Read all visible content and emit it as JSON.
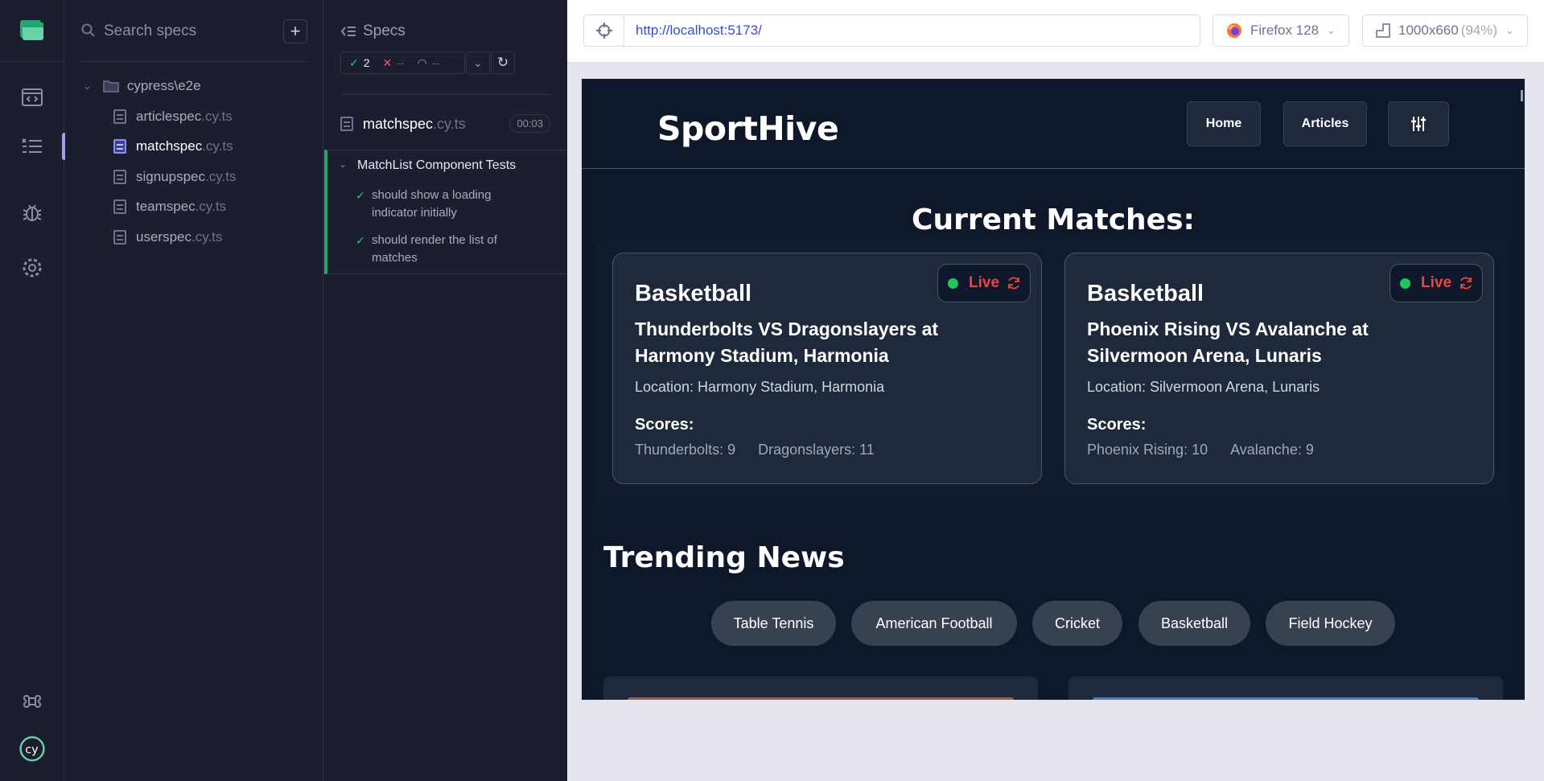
{
  "specs_panel": {
    "search_placeholder": "Search specs",
    "add_label": "+",
    "folder": "cypress\\e2e",
    "files": [
      {
        "name": "articlespec",
        "ext": ".cy.ts"
      },
      {
        "name": "matchspec",
        "ext": ".cy.ts"
      },
      {
        "name": "signupspec",
        "ext": ".cy.ts"
      },
      {
        "name": "teamspec",
        "ext": ".cy.ts"
      },
      {
        "name": "userspec",
        "ext": ".cy.ts"
      }
    ],
    "selected_file": "matchspec"
  },
  "reporter": {
    "title": "Specs",
    "passed": "2",
    "failed": "--",
    "pending": "--",
    "spec_name": "matchspec",
    "spec_ext": ".cy.ts",
    "duration": "00:03",
    "suite": "MatchList Component Tests",
    "tests": [
      "should show a loading indicator initially",
      "should render the list of matches"
    ]
  },
  "toolbar": {
    "url": "http://localhost:5173/",
    "browser": "Firefox 128",
    "viewport_size": "1000x660",
    "viewport_scale": "(94%)"
  },
  "app": {
    "brand": "SportHive",
    "nav": {
      "home": "Home",
      "articles": "Articles"
    },
    "current_matches_title": "Current Matches:",
    "matches": [
      {
        "sport": "Basketball",
        "title": "Thunderbolts VS Dragonslayers at Harmony Stadium, Harmonia",
        "location": "Location: Harmony Stadium, Harmonia",
        "scores_label": "Scores:",
        "team_a": "Thunderbolts: 9",
        "team_b": "Dragonslayers: 11",
        "status": "Live"
      },
      {
        "sport": "Basketball",
        "title": "Phoenix Rising VS Avalanche at Silvermoon Arena, Lunaris",
        "location": "Location: Silvermoon Arena, Lunaris",
        "scores_label": "Scores:",
        "team_a": "Phoenix Rising: 10",
        "team_b": "Avalanche: 9",
        "status": "Live"
      }
    ],
    "trending_title": "Trending News",
    "categories": [
      "Table Tennis",
      "American Football",
      "Cricket",
      "Basketball",
      "Field Hockey"
    ]
  },
  "colors": {
    "accent_green": "#22c55e",
    "live_red": "#ef4444",
    "app_bg": "#0f172a",
    "card_bg": "#1e293b",
    "selected_file": "#8b8ff0",
    "pass_green": "#1fa971"
  }
}
